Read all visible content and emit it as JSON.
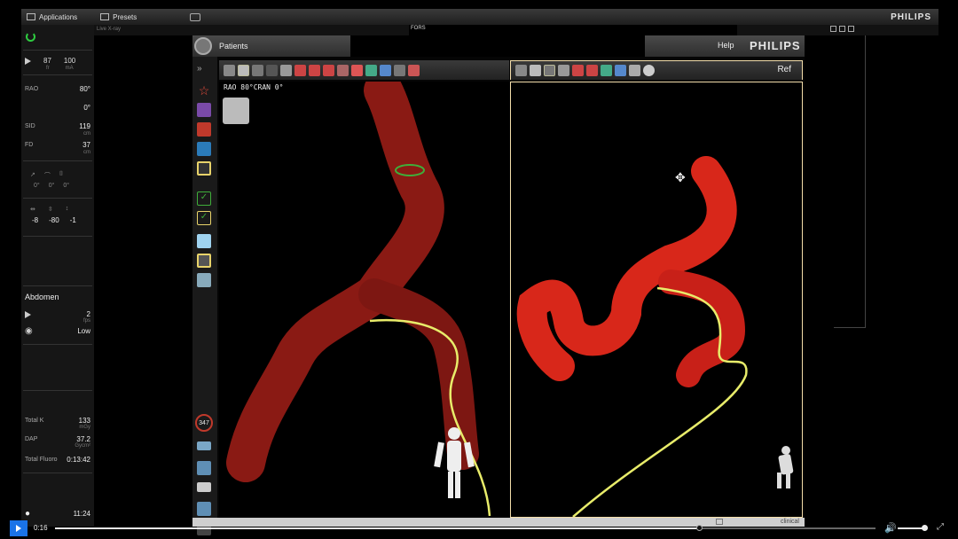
{
  "topbar": {
    "applications_label": "Applications",
    "presets_label": "Presets",
    "brand": "PHILIPS"
  },
  "left_panel": {
    "frame_rate": "87",
    "frame_rate_unit": "fr",
    "kv": "100",
    "kv_unit": "mA",
    "rao_label": "RAO",
    "rao_value": "80°",
    "cran_value": "0°",
    "sid_label": "SID",
    "sid_value": "119",
    "sid_unit": "cm",
    "fd_label": "FD",
    "fd_value": "37",
    "fd_unit": "cm",
    "geom_a": "0°",
    "geom_b": "0°",
    "geom_c": "0°",
    "table_x": "-8",
    "table_y": "-80",
    "table_z": "-1",
    "protocol": "Abdomen",
    "protocol_rate": "2",
    "protocol_rate_unit": "fps",
    "dose_mode": "Low",
    "total_k_label": "Total K",
    "total_k_value": "133",
    "total_k_unit": "mGy",
    "dap_label": "DAP",
    "dap_value": "37.2",
    "dap_unit": "Gycm²",
    "fluoro_label": "Total Fluoro",
    "fluoro_value": "0:13:42",
    "clock": "11:24"
  },
  "band": {
    "live_label": "Live X-ray",
    "fors_label": "FORS"
  },
  "app": {
    "patients_label": "Patients",
    "help_label": "Help",
    "brand": "PHILIPS",
    "ref_label": "Ref",
    "rao_overlay": "RAO 80°CRAN 0°",
    "counter": "347",
    "status_clinical": "clinical"
  },
  "video": {
    "current_time": "0:16",
    "progress": 0.785
  },
  "colors": {
    "vessel": "#b3221a",
    "guidewire": "#e8ec6a",
    "catheter_ring": "#3fae3a",
    "video_accent": "#1a73e8"
  }
}
